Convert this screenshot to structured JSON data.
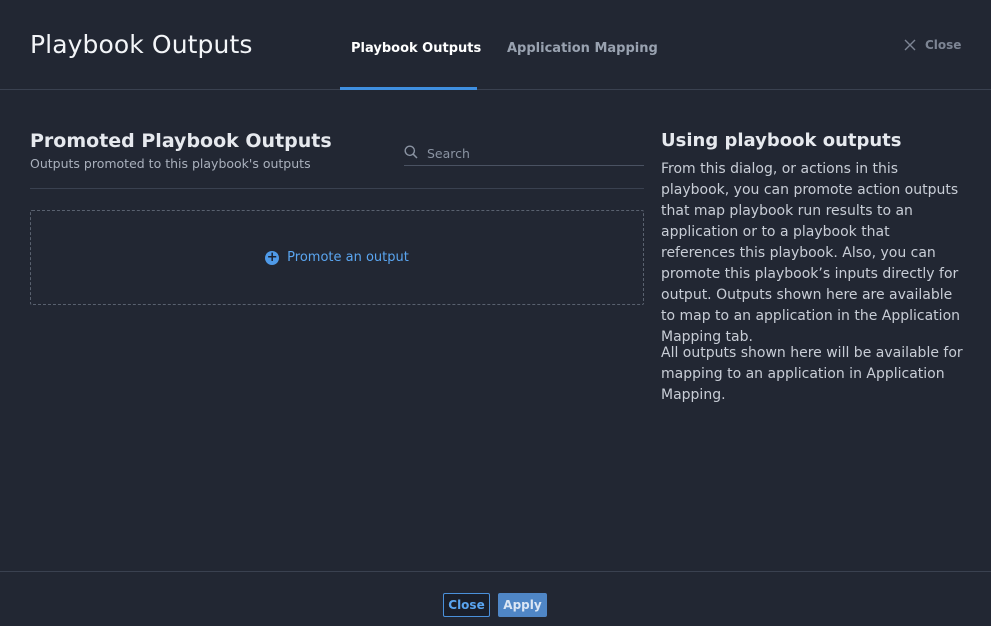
{
  "header": {
    "title": "Playbook Outputs",
    "tabs": [
      {
        "label": "Playbook Outputs",
        "active": true
      },
      {
        "label": "Application Mapping",
        "active": false
      }
    ],
    "close_label": "Close"
  },
  "left": {
    "title": "Promoted Playbook Outputs",
    "subtitle": "Outputs promoted to this playbook's outputs",
    "search_placeholder": "Search",
    "promote_label": "Promote an output"
  },
  "help": {
    "title": "Using playbook outputs",
    "paragraph1": "From this dialog, or actions in this playbook, you can promote action outputs that map playbook run results to an application or to a playbook that references this playbook. Also, you can promote this playbook’s inputs directly for output. Outputs shown here are available to map to an application in the Application Mapping tab.",
    "paragraph2": "All outputs shown here will be available for mapping to an application in Application Mapping."
  },
  "footer": {
    "close_label": "Close",
    "apply_label": "Apply"
  },
  "colors": {
    "background": "#222733",
    "accent": "#3f8fe0",
    "link": "#5aa5f0"
  },
  "icons": {
    "close": "close-icon",
    "search": "search-icon",
    "add": "plus-circle-icon"
  }
}
